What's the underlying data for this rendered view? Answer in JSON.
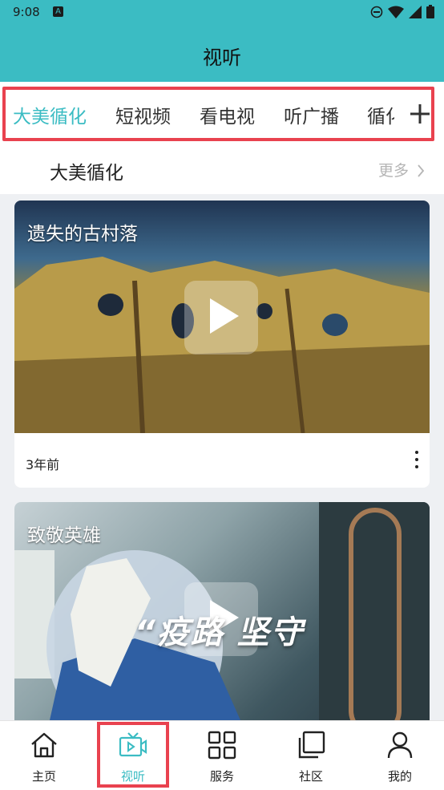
{
  "status_bar": {
    "time": "9:08",
    "notif_icon": "A"
  },
  "app_bar": {
    "title": "视听"
  },
  "tabs": [
    {
      "label": "大美循化",
      "active": true
    },
    {
      "label": "短视频",
      "active": false
    },
    {
      "label": "看电视",
      "active": false
    },
    {
      "label": "听广播",
      "active": false
    },
    {
      "label": "循化",
      "active": false
    }
  ],
  "add_tab_icon": "plus-icon",
  "section": {
    "title": "大美循化",
    "more": "更多"
  },
  "videos": [
    {
      "title": "遗失的古村落",
      "time_ago": "3年前"
    },
    {
      "title": "致敬英雄",
      "overlay": "“疫路 坚守"
    }
  ],
  "bottom_nav": [
    {
      "label": "主页",
      "icon": "home-icon",
      "active": false
    },
    {
      "label": "视听",
      "icon": "tv-icon",
      "active": true
    },
    {
      "label": "服务",
      "icon": "grid-icon",
      "active": false
    },
    {
      "label": "社区",
      "icon": "stack-icon",
      "active": false
    },
    {
      "label": "我的",
      "icon": "user-icon",
      "active": false
    }
  ],
  "colors": {
    "accent": "#3bbcc3",
    "highlight_frame": "#e9424f"
  }
}
